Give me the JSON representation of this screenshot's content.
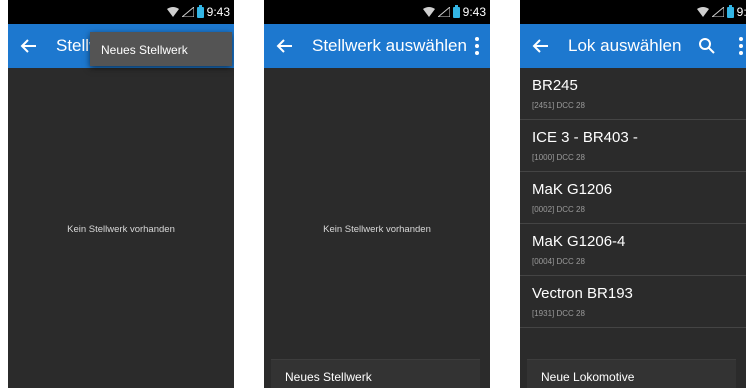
{
  "status": {
    "time": "9:43"
  },
  "panel1": {
    "title": "Stellw",
    "popup_item": "Neues Stellwerk",
    "empty_text": "Kein Stellwerk vorhanden"
  },
  "panel2": {
    "title": "Stellwerk auswählen",
    "empty_text": "Kein Stellwerk vorhanden",
    "bottom_button": "Neues Stellwerk"
  },
  "panel3": {
    "title": "Lok auswählen",
    "items": [
      {
        "name": "BR245",
        "sub": "[2451]  DCC 28"
      },
      {
        "name": "ICE 3 - BR403 -",
        "sub": "[1000]  DCC 28"
      },
      {
        "name": "MaK G1206",
        "sub": "[0002]  DCC 28"
      },
      {
        "name": "MaK G1206-4",
        "sub": "[0004]  DCC 28"
      },
      {
        "name": "Vectron BR193",
        "sub": "[1931]  DCC 28"
      }
    ],
    "bottom_button": "Neue Lokomotive"
  },
  "colors": {
    "appbar": "#1d78cf",
    "background": "#2b2b2b",
    "statusbar": "#000000",
    "battery": "#33b5e5"
  },
  "icons": [
    "back-arrow-icon",
    "overflow-menu-icon",
    "search-icon",
    "wifi-icon",
    "battery-icon"
  ]
}
